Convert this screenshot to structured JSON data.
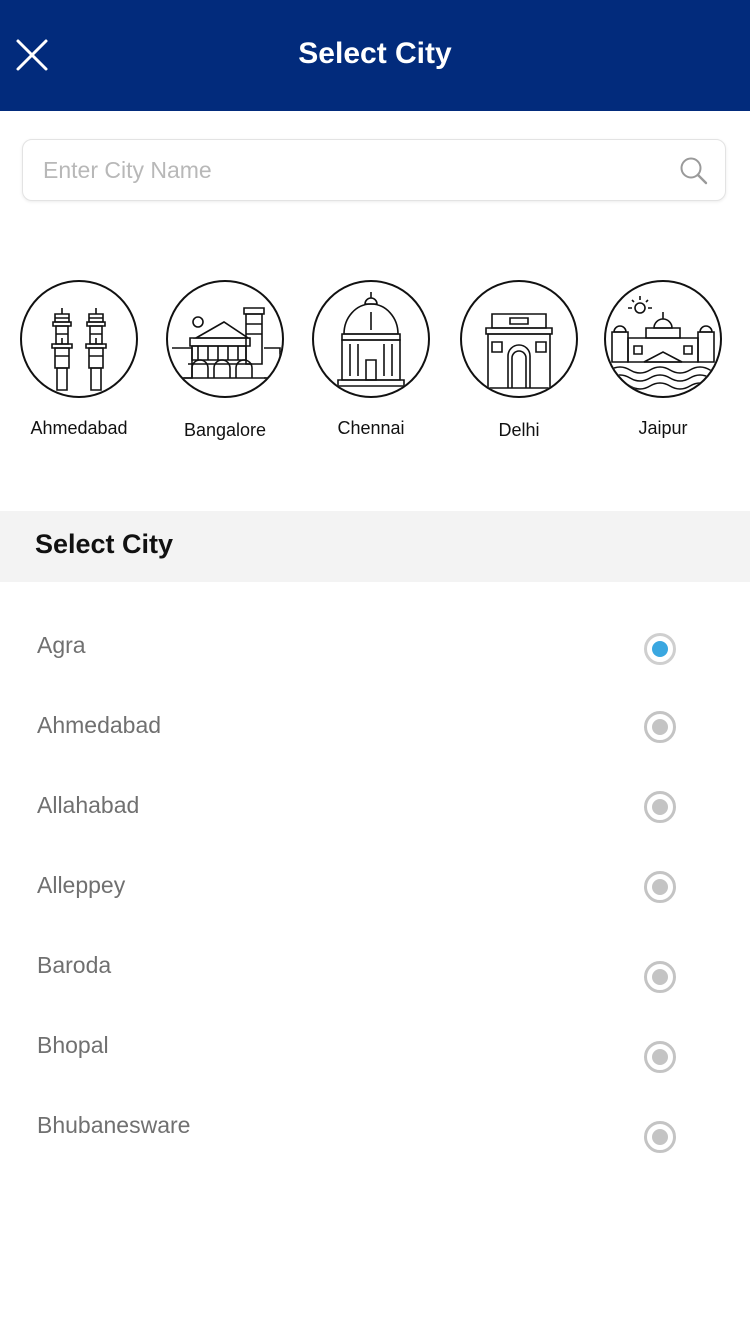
{
  "header": {
    "title": "Select City",
    "close_icon": "close-icon"
  },
  "search": {
    "placeholder": "Enter City Name",
    "value": "",
    "icon": "search-icon"
  },
  "popular_cities": [
    {
      "name": "Ahmedabad",
      "icon": "ahmedabad-minarets-icon"
    },
    {
      "name": "Bangalore",
      "icon": "bangalore-palace-icon"
    },
    {
      "name": "Chennai",
      "icon": "chennai-building-icon"
    },
    {
      "name": "Delhi",
      "icon": "india-gate-icon"
    },
    {
      "name": "Jaipur",
      "icon": "jaipur-palace-icon"
    }
  ],
  "section": {
    "title": "Select City"
  },
  "cities": [
    {
      "name": "Agra",
      "selected": true
    },
    {
      "name": "Ahmedabad",
      "selected": false
    },
    {
      "name": "Allahabad",
      "selected": false
    },
    {
      "name": "Alleppey",
      "selected": false
    },
    {
      "name": "Baroda",
      "selected": false
    },
    {
      "name": "Bhopal",
      "selected": false
    },
    {
      "name": "Bhubanesware",
      "selected": false
    }
  ],
  "colors": {
    "header_bg": "#022b7c",
    "radio_selected": "#3aa7e0",
    "radio_unselected": "#c4c4c4",
    "section_bg": "#f3f3f3"
  }
}
